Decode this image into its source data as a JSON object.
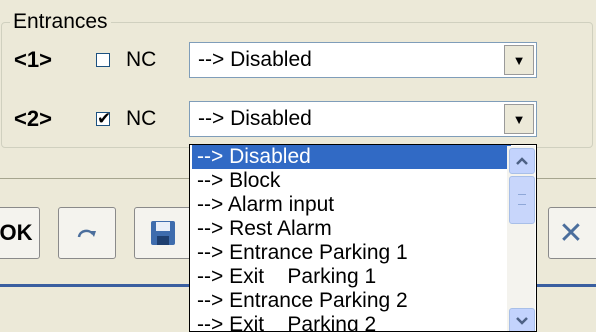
{
  "group": {
    "title": "Entrances"
  },
  "rows": [
    {
      "label": "<1>",
      "checked": false,
      "nc_label": "NC",
      "value": "--> Disabled"
    },
    {
      "label": "<2>",
      "checked": true,
      "nc_label": "NC",
      "value": "--> Disabled"
    }
  ],
  "toolbar": {
    "ok_label": "OK",
    "close_glyph": "✕",
    "icons": [
      "redo-icon",
      "save-icon"
    ]
  },
  "dropdown": {
    "selected_index": 0,
    "options": [
      "--> Disabled",
      "--> Block",
      "--> Alarm input",
      "--> Rest Alarm",
      "--> Entrance Parking 1",
      "--> Exit    Parking 1",
      "--> Entrance Parking 2",
      "--> Exit    Parking 2"
    ]
  },
  "colors": {
    "selection": "#316ac5",
    "window": "#ece9d8",
    "divider": "#3a5fa0"
  }
}
